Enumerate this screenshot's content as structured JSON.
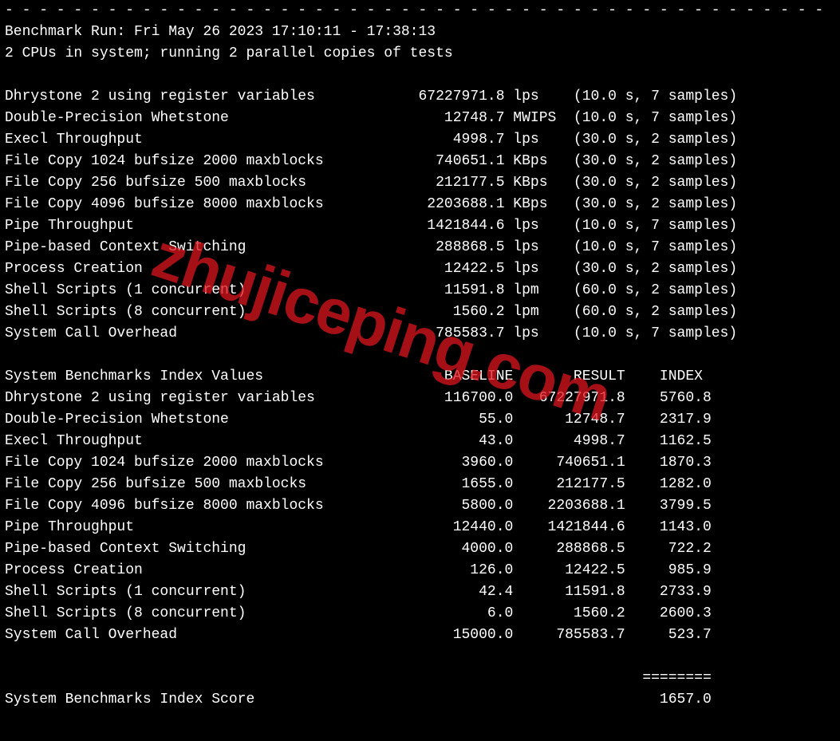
{
  "watermark": "zhujiceping.com",
  "dashes": "- - - - - - - - - - - - - - - - - - - - - - - - - - - - - - - - - - - - - - - - - - - - - - - - - - -",
  "header": {
    "run_line": "Benchmark Run: Fri May 26 2023 17:10:11 - 17:38:13",
    "cpu_line": "2 CPUs in system; running 2 parallel copies of tests"
  },
  "tests": [
    {
      "name": "Dhrystone 2 using register variables",
      "value": "67227971.8",
      "unit": "lps",
      "time": "10.0",
      "samples": "7"
    },
    {
      "name": "Double-Precision Whetstone",
      "value": "12748.7",
      "unit": "MWIPS",
      "time": "10.0",
      "samples": "7"
    },
    {
      "name": "Execl Throughput",
      "value": "4998.7",
      "unit": "lps",
      "time": "30.0",
      "samples": "2"
    },
    {
      "name": "File Copy 1024 bufsize 2000 maxblocks",
      "value": "740651.1",
      "unit": "KBps",
      "time": "30.0",
      "samples": "2"
    },
    {
      "name": "File Copy 256 bufsize 500 maxblocks",
      "value": "212177.5",
      "unit": "KBps",
      "time": "30.0",
      "samples": "2"
    },
    {
      "name": "File Copy 4096 bufsize 8000 maxblocks",
      "value": "2203688.1",
      "unit": "KBps",
      "time": "30.0",
      "samples": "2"
    },
    {
      "name": "Pipe Throughput",
      "value": "1421844.6",
      "unit": "lps",
      "time": "10.0",
      "samples": "7"
    },
    {
      "name": "Pipe-based Context Switching",
      "value": "288868.5",
      "unit": "lps",
      "time": "10.0",
      "samples": "7"
    },
    {
      "name": "Process Creation",
      "value": "12422.5",
      "unit": "lps",
      "time": "30.0",
      "samples": "2"
    },
    {
      "name": "Shell Scripts (1 concurrent)",
      "value": "11591.8",
      "unit": "lpm",
      "time": "60.0",
      "samples": "2"
    },
    {
      "name": "Shell Scripts (8 concurrent)",
      "value": "1560.2",
      "unit": "lpm",
      "time": "60.0",
      "samples": "2"
    },
    {
      "name": "System Call Overhead",
      "value": "785583.7",
      "unit": "lps",
      "time": "10.0",
      "samples": "7"
    }
  ],
  "index_header": {
    "title": "System Benchmarks Index Values",
    "baseline": "BASELINE",
    "result": "RESULT",
    "index": "INDEX"
  },
  "index_rows": [
    {
      "name": "Dhrystone 2 using register variables",
      "baseline": "116700.0",
      "result": "67227971.8",
      "index": "5760.8"
    },
    {
      "name": "Double-Precision Whetstone",
      "baseline": "55.0",
      "result": "12748.7",
      "index": "2317.9"
    },
    {
      "name": "Execl Throughput",
      "baseline": "43.0",
      "result": "4998.7",
      "index": "1162.5"
    },
    {
      "name": "File Copy 1024 bufsize 2000 maxblocks",
      "baseline": "3960.0",
      "result": "740651.1",
      "index": "1870.3"
    },
    {
      "name": "File Copy 256 bufsize 500 maxblocks",
      "baseline": "1655.0",
      "result": "212177.5",
      "index": "1282.0"
    },
    {
      "name": "File Copy 4096 bufsize 8000 maxblocks",
      "baseline": "5800.0",
      "result": "2203688.1",
      "index": "3799.5"
    },
    {
      "name": "Pipe Throughput",
      "baseline": "12440.0",
      "result": "1421844.6",
      "index": "1143.0"
    },
    {
      "name": "Pipe-based Context Switching",
      "baseline": "4000.0",
      "result": "288868.5",
      "index": "722.2"
    },
    {
      "name": "Process Creation",
      "baseline": "126.0",
      "result": "12422.5",
      "index": "985.9"
    },
    {
      "name": "Shell Scripts (1 concurrent)",
      "baseline": "42.4",
      "result": "11591.8",
      "index": "2733.9"
    },
    {
      "name": "Shell Scripts (8 concurrent)",
      "baseline": "6.0",
      "result": "1560.2",
      "index": "2600.3"
    },
    {
      "name": "System Call Overhead",
      "baseline": "15000.0",
      "result": "785583.7",
      "index": "523.7"
    }
  ],
  "footer": {
    "divider": "========",
    "score_label": "System Benchmarks Index Score",
    "score_value": "1657.0"
  }
}
